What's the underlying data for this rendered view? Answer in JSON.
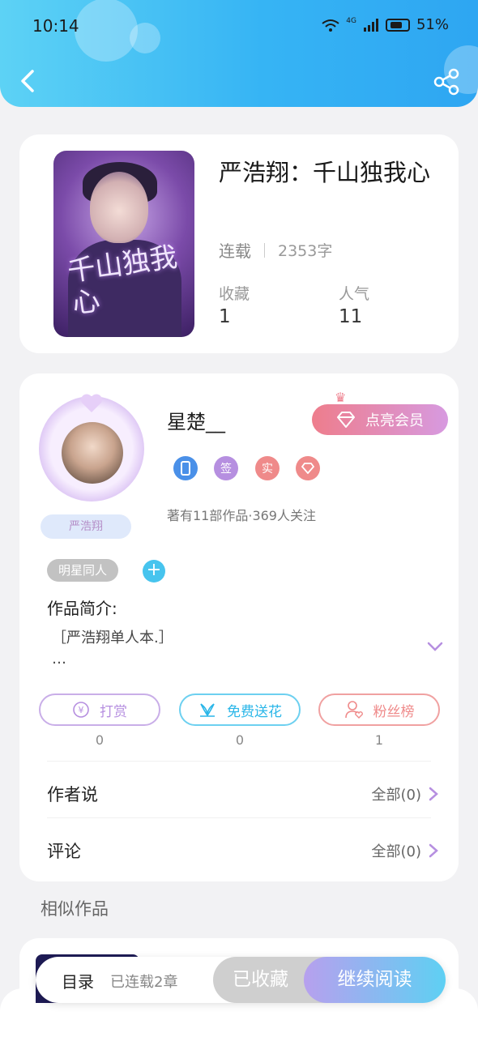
{
  "status_bar": {
    "time": "10:14",
    "network": "4G",
    "battery": "51%"
  },
  "book": {
    "title": "严浩翔：千山独我心",
    "cover_text": "千山独我心",
    "status": "连载",
    "word_count": "2353字",
    "stats": [
      {
        "label": "收藏",
        "value": "1"
      },
      {
        "label": "人气",
        "value": "11"
      }
    ]
  },
  "author": {
    "name": "星楚__",
    "avatar_tag": "严浩翔",
    "vip_label": "点亮会员",
    "badges": [
      {
        "icon": "phone-icon",
        "text": "",
        "color": "#4a90e8"
      },
      {
        "icon": "sign-badge",
        "text": "签",
        "color": "#b68fe0"
      },
      {
        "icon": "verified-badge",
        "text": "实",
        "color": "#ef8a8a"
      },
      {
        "icon": "diamond-icon",
        "text": "",
        "color": "#ef8a8a"
      }
    ],
    "meta": "著有11部作品·369人关注"
  },
  "tags": [
    "明星同人"
  ],
  "intro": {
    "label": "作品简介:",
    "text": "［严浩翔单人本.］",
    "ellipsis": "…"
  },
  "actions": [
    {
      "label": "打赏",
      "count": "0",
      "icon": "yen-icon",
      "color": "#b68fe0"
    },
    {
      "label": "免费送花",
      "count": "0",
      "icon": "flower-icon",
      "color": "#47c4ee"
    },
    {
      "label": "粉丝榜",
      "count": "1",
      "icon": "fans-icon",
      "color": "#ef8a8a"
    }
  ],
  "rows": [
    {
      "label": "作者说",
      "link": "全部(0)"
    },
    {
      "label": "评论",
      "link": "全部(0)"
    }
  ],
  "similar": {
    "title": "相似作品"
  },
  "bottom_bar": {
    "toc_label": "目录",
    "toc_count": "已连载2章",
    "collected_label": "已收藏",
    "read_label": "继续阅读"
  }
}
